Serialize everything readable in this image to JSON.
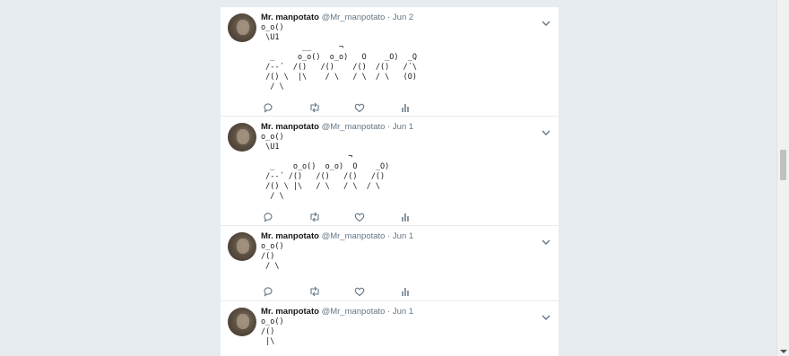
{
  "colors": {
    "background": "#e6ecf0",
    "card": "#ffffff",
    "secondary_text": "#657786",
    "icon": "#657786"
  },
  "tweets": [
    {
      "name": "Mr. manpotato",
      "handle": "@Mr_manpotato",
      "dot": "·",
      "date": "Jun 2",
      "art": "o_o()\n \\U1\n         __      ¬\n  _     o_o()  o_o)   O    _O)  _Q\n /--´  /()   /()    /()  /()   /´\\\n /() \\  |\\    / \\   / \\  / \\   (O)\n  / \\"
    },
    {
      "name": "Mr. manpotato",
      "handle": "@Mr_manpotato",
      "dot": "·",
      "date": "Jun 1",
      "art": "o_o()\n \\U1\n                   ¬\n  _    o_o()  o_o)  O    _O)\n /--´ /()   /()   /()   /()\n /() \\ |\\   / \\   / \\  / \\\n  / \\"
    },
    {
      "name": "Mr. manpotato",
      "handle": "@Mr_manpotato",
      "dot": "·",
      "date": "Jun 1",
      "art": "o_o()\n/()\n / \\"
    },
    {
      "name": "Mr. manpotato",
      "handle": "@Mr_manpotato",
      "dot": "·",
      "date": "Jun 1",
      "art": "o_o()\n/()\n |\\"
    }
  ],
  "icons": {
    "reply": "reply-icon",
    "retweet": "retweet-icon",
    "like": "heart-icon",
    "analytics": "analytics-icon",
    "menu": "chevron-down-icon"
  }
}
